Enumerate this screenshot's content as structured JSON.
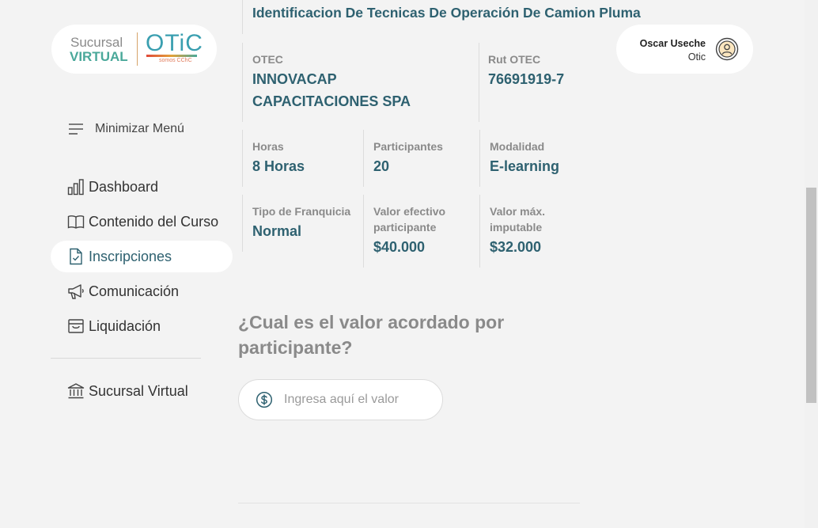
{
  "logo": {
    "sucursal": "Sucursal",
    "virtual": "VIRTUAL",
    "otic": "OTiC",
    "sub": "somos CChC"
  },
  "sidebar": {
    "menu_toggle_label": "Minimizar Menú",
    "items": [
      {
        "label": "Dashboard",
        "icon": "bar-chart-icon"
      },
      {
        "label": "Contenido del Curso",
        "icon": "book-icon"
      },
      {
        "label": "Inscripciones",
        "icon": "document-check-icon",
        "active": true
      },
      {
        "label": "Comunicación",
        "icon": "megaphone-icon"
      },
      {
        "label": "Liquidación",
        "icon": "archive-icon"
      }
    ],
    "footer_item": {
      "label": "Sucursal Virtual",
      "icon": "bank-icon"
    }
  },
  "course": {
    "title": "Identificacion De Tecnicas De Operación De Camion Pluma",
    "otec_label": "OTEC",
    "otec_value": "INNOVACAP CAPACITACIONES SPA",
    "rut_label": "Rut OTEC",
    "rut_value": "76691919-7",
    "horas_label": "Horas",
    "horas_value": "8 Horas",
    "participantes_label": "Participantes",
    "participantes_value": "20",
    "modalidad_label": "Modalidad",
    "modalidad_value": "E-learning",
    "franquicia_label": "Tipo de Franquicia",
    "franquicia_value": "Normal",
    "valor_efectivo_label": "Valor efectivo participante",
    "valor_efectivo_value": "$40.000",
    "valor_max_label": "Valor máx. imputable",
    "valor_max_value": "$32.000"
  },
  "form": {
    "question": "¿Cual es el valor acordado por participante?",
    "value_placeholder": "Ingresa aquí el valor",
    "value": ""
  },
  "user": {
    "name": "Oscar Useche",
    "role": "Otic"
  },
  "colors": {
    "accent": "#2e6170",
    "brand_green": "#4aa89a",
    "muted": "#8a8a8a",
    "background": "#f3f3f3"
  }
}
